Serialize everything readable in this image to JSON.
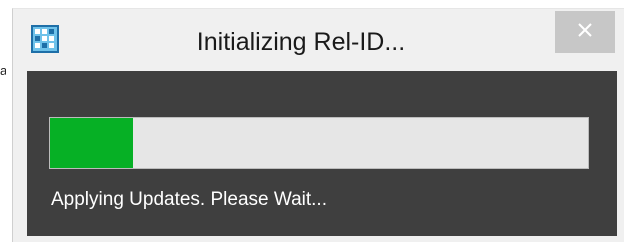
{
  "window": {
    "title": "Initializing Rel-ID...",
    "close_label": "×",
    "app_icon": "app-grid-icon"
  },
  "backdrop": {
    "glyph": "a"
  },
  "progress": {
    "fraction": 0.155,
    "fill_color": "#06b025",
    "status": "Applying Updates. Please Wait..."
  },
  "colors": {
    "panel": "#3f3f3f",
    "track": "#e6e6e6",
    "close_button": "#c7c7c7"
  }
}
